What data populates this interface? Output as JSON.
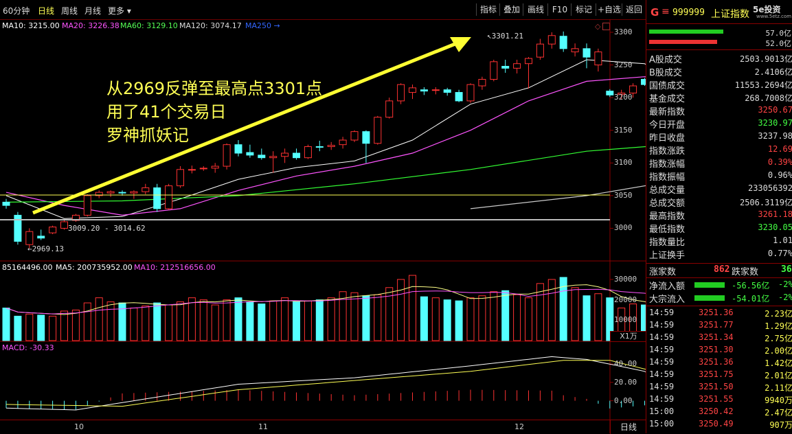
{
  "toolbar": {
    "periods": [
      {
        "label": "60分钟",
        "active": false
      },
      {
        "label": "日线",
        "active": true
      },
      {
        "label": "周线",
        "active": false
      },
      {
        "label": "月线",
        "active": false
      },
      {
        "label": "更多 ▾",
        "active": false
      }
    ],
    "buttons": [
      "指标",
      "叠加",
      "画线",
      "F10",
      "标记",
      "+自选",
      "返回"
    ]
  },
  "ma_line": [
    {
      "label": "MA10: 3215.00",
      "color": "#ffffff"
    },
    {
      "label": "MA20: 3226.38",
      "color": "#ff55ff"
    },
    {
      "label": "MA60: 3129.10",
      "color": "#55ff55"
    },
    {
      "label": "MA120: 3074.17",
      "color": "#dddddd"
    },
    {
      "label": "MA250 →",
      "color": "#3366ff"
    }
  ],
  "vol_line": [
    {
      "label": "85164496.00",
      "color": "#ffffff"
    },
    {
      "label": "MA5: 200735952.00",
      "color": "#ffffff"
    },
    {
      "label": "MA10: 212516656.00",
      "color": "#ff55ff"
    }
  ],
  "macd_label": "MACD: -30.33",
  "annotation": [
    "从2969反弹至最高点3301点",
    "用了41个交易日",
    "罗神抓妖记"
  ],
  "price_labels": {
    "high": "3301.21",
    "low": "2969.13",
    "range": "3009.20 - 3014.62"
  },
  "price_axis": [
    "3300",
    "3250",
    "3200",
    "3150",
    "3100",
    "3050",
    "3000"
  ],
  "vol_axis": [
    "30000",
    "20000",
    "10000"
  ],
  "vol_unit": "X1万",
  "macd_axis": [
    "40.00",
    "20.00",
    "0.00"
  ],
  "date_axis": [
    "10",
    "11",
    "12"
  ],
  "period_tab": "日线",
  "logo": "5e投资",
  "logo_sub": "www.5etz.com",
  "header": {
    "key": "G",
    "code": "999999",
    "name": "上证指数"
  },
  "bars": [
    {
      "value": "57.0亿",
      "color": "#22cc22",
      "fill": 0.72
    },
    {
      "value": "52.0亿",
      "color": "#ee3333",
      "fill": 0.66
    }
  ],
  "stats": [
    {
      "label": "A股成交",
      "value": "2503.9013亿",
      "color": "#dddddd"
    },
    {
      "label": "B股成交",
      "value": "2.4106亿",
      "color": "#dddddd"
    },
    {
      "label": "国债成交",
      "value": "11553.2694亿",
      "color": "#dddddd"
    },
    {
      "label": "基金成交",
      "value": "268.7008亿",
      "color": "#dddddd"
    },
    {
      "label": "最新指数",
      "value": "3250.67",
      "color": "#ff4444"
    },
    {
      "label": "今日开盘",
      "value": "3230.97",
      "color": "#44ff44"
    },
    {
      "label": "昨日收盘",
      "value": "3237.98",
      "color": "#dddddd"
    },
    {
      "label": "指数涨跌",
      "value": "12.69",
      "color": "#ff4444"
    },
    {
      "label": "指数涨幅",
      "value": "0.39%",
      "color": "#ff4444"
    },
    {
      "label": "指数振幅",
      "value": "0.96%",
      "color": "#dddddd"
    },
    {
      "label": "总成交量",
      "value": "233056392",
      "color": "#dddddd"
    },
    {
      "label": "总成交额",
      "value": "2506.3119亿",
      "color": "#dddddd"
    },
    {
      "label": "最高指数",
      "value": "3261.18",
      "color": "#ff4444"
    },
    {
      "label": "最低指数",
      "value": "3230.05",
      "color": "#44ff44"
    },
    {
      "label": "指数量比",
      "value": "1.01",
      "color": "#dddddd"
    },
    {
      "label": "上证换手",
      "value": "0.77%",
      "color": "#dddddd"
    }
  ],
  "breadth": {
    "up_label": "涨家数",
    "up": "862",
    "down_label": "跌家数",
    "down": "360"
  },
  "flows": [
    {
      "label": "净流入额",
      "value": "-56.56亿",
      "pct": "-2%",
      "bar_color": "#22cc22"
    },
    {
      "label": "大宗流入",
      "value": "-54.01亿",
      "pct": "-2%",
      "bar_color": "#22cc22"
    }
  ],
  "ticks": [
    {
      "time": "14:59",
      "price": "3251.36",
      "vol": "2.23亿"
    },
    {
      "time": "14:59",
      "price": "3251.77",
      "vol": "1.29亿"
    },
    {
      "time": "14:59",
      "price": "3251.34",
      "vol": "2.75亿"
    },
    {
      "time": "14:59",
      "price": "3251.30",
      "vol": "2.00亿"
    },
    {
      "time": "14:59",
      "price": "3251.36",
      "vol": "1.42亿"
    },
    {
      "time": "14:59",
      "price": "3251.75",
      "vol": "2.01亿"
    },
    {
      "time": "14:59",
      "price": "3251.50",
      "vol": "2.11亿"
    },
    {
      "time": "14:59",
      "price": "3251.55",
      "vol": "9940万"
    },
    {
      "time": "15:00",
      "price": "3250.42",
      "vol": "2.47亿"
    },
    {
      "time": "15:00",
      "price": "3250.49",
      "vol": "907万"
    }
  ],
  "colors": {
    "up": "#ff3232",
    "down": "#54ffff",
    "bg": "#000000",
    "frame": "#8a0000",
    "annotation": "#ffff55"
  },
  "chart_data": {
    "type": "candlestick",
    "price_range": [
      2950,
      3320
    ],
    "candles": [
      [
        3040,
        3045,
        3030,
        3035
      ],
      [
        3020,
        3025,
        2975,
        2980
      ],
      [
        2975,
        3000,
        2969.13,
        2995
      ],
      [
        2988,
        2998,
        2982,
        2985
      ],
      [
        2993,
        3004,
        2991,
        3002
      ],
      [
        3000,
        3012,
        2998,
        3010
      ],
      [
        3012,
        3022,
        3010,
        3020
      ],
      [
        3020,
        3052,
        3018,
        3050
      ],
      [
        3050,
        3058,
        3046,
        3055
      ],
      [
        3054,
        3058,
        3048,
        3056
      ],
      [
        3055,
        3058,
        3050,
        3054
      ],
      [
        3054,
        3058,
        3045,
        3056
      ],
      [
        3056,
        3068,
        3052,
        3062
      ],
      [
        3062,
        3068,
        3025,
        3030
      ],
      [
        3030,
        3068,
        3028,
        3065
      ],
      [
        3065,
        3095,
        3062,
        3090
      ],
      [
        3090,
        3096,
        3084,
        3090
      ],
      [
        3091,
        3095,
        3088,
        3092
      ],
      [
        3092,
        3100,
        3085,
        3095
      ],
      [
        3095,
        3130,
        3090,
        3128
      ],
      [
        3128,
        3135,
        3110,
        3115
      ],
      [
        3116,
        3128,
        3108,
        3112
      ],
      [
        3112,
        3122,
        3105,
        3108
      ],
      [
        3108,
        3118,
        3085,
        3110
      ],
      [
        3110,
        3122,
        3100,
        3115
      ],
      [
        3115,
        3122,
        3105,
        3108
      ],
      [
        3108,
        3128,
        3106,
        3125
      ],
      [
        3125,
        3134,
        3118,
        3124
      ],
      [
        3125,
        3132,
        3120,
        3127
      ],
      [
        3128,
        3140,
        3122,
        3135
      ],
      [
        3135,
        3150,
        3132,
        3148
      ],
      [
        3148,
        3150,
        3100,
        3130
      ],
      [
        3130,
        3172,
        3128,
        3170
      ],
      [
        3170,
        3200,
        3168,
        3195
      ],
      [
        3195,
        3222,
        3190,
        3220
      ],
      [
        3208,
        3220,
        3198,
        3215
      ],
      [
        3212,
        3216,
        3204,
        3210
      ],
      [
        3212,
        3216,
        3205,
        3212
      ],
      [
        3212,
        3215,
        3203,
        3208
      ],
      [
        3208,
        3212,
        3193,
        3195
      ],
      [
        3195,
        3222,
        3192,
        3220
      ],
      [
        3218,
        3232,
        3212,
        3228
      ],
      [
        3228,
        3258,
        3225,
        3255
      ],
      [
        3248,
        3258,
        3238,
        3245
      ],
      [
        3245,
        3258,
        3237,
        3252
      ],
      [
        3252,
        3262,
        3214,
        3260
      ],
      [
        3262,
        3290,
        3258,
        3282
      ],
      [
        3282,
        3300,
        3275,
        3295
      ],
      [
        3294,
        3301.21,
        3270,
        3275
      ],
      [
        3270,
        3283,
        3263,
        3275
      ],
      [
        3275,
        3283,
        3245,
        3262
      ],
      [
        3250,
        3275,
        3240,
        3270
      ],
      [
        3210,
        3213,
        3201,
        3204
      ],
      [
        3205,
        3212,
        3198,
        3207
      ],
      [
        3207,
        3222,
        3200,
        3218
      ],
      [
        3228,
        3230,
        3218,
        3220
      ],
      [
        3223,
        3230,
        3212,
        3225
      ],
      [
        3233,
        3238,
        3148,
        3152
      ],
      [
        3152,
        3162,
        3128,
        3145
      ]
    ],
    "volume": [
      16000,
      12000,
      13000,
      12500,
      12000,
      14500,
      15000,
      18500,
      21000,
      19000,
      18500,
      16000,
      17000,
      18500,
      17500,
      19000,
      21000,
      20000,
      17500,
      20000,
      21000,
      19000,
      18000,
      19500,
      21000,
      19000,
      19500,
      20000,
      21000,
      24000,
      23500,
      22000,
      22500,
      26000,
      30000,
      32000,
      21500,
      21000,
      20000,
      19500,
      21000,
      22000,
      24000,
      24500,
      22500,
      21000,
      28000,
      30000,
      31000,
      26000,
      22000,
      23000,
      21000,
      16000,
      18000,
      17500,
      16500,
      28000,
      19000
    ],
    "ma_series": {
      "MA10": [
        [
          0,
          3050
        ],
        [
          5,
          3015
        ],
        [
          10,
          3018
        ],
        [
          15,
          3045
        ],
        [
          20,
          3075
        ],
        [
          25,
          3093
        ],
        [
          30,
          3103
        ],
        [
          35,
          3135
        ],
        [
          40,
          3190
        ],
        [
          45,
          3215
        ],
        [
          50,
          3258
        ],
        [
          55,
          3252
        ],
        [
          58,
          3215
        ]
      ],
      "MA20": [
        [
          0,
          3055
        ],
        [
          5,
          3035
        ],
        [
          10,
          3020
        ],
        [
          15,
          3030
        ],
        [
          20,
          3058
        ],
        [
          25,
          3080
        ],
        [
          30,
          3095
        ],
        [
          35,
          3115
        ],
        [
          40,
          3150
        ],
        [
          45,
          3195
        ],
        [
          50,
          3225
        ],
        [
          55,
          3232
        ],
        [
          58,
          3226
        ]
      ],
      "MA60": [
        [
          0,
          3040
        ],
        [
          10,
          3042
        ],
        [
          20,
          3050
        ],
        [
          30,
          3068
        ],
        [
          40,
          3090
        ],
        [
          50,
          3118
        ],
        [
          58,
          3129
        ]
      ],
      "MA120": [
        [
          40,
          3030
        ],
        [
          50,
          3050
        ],
        [
          58,
          3074
        ]
      ]
    },
    "macd_series": {
      "DIF": [
        [
          0,
          -8
        ],
        [
          6,
          -10
        ],
        [
          10,
          -2
        ],
        [
          20,
          18
        ],
        [
          30,
          25
        ],
        [
          40,
          38
        ],
        [
          47,
          48
        ],
        [
          50,
          45
        ],
        [
          55,
          32
        ],
        [
          58,
          10
        ]
      ],
      "DEA": [
        [
          0,
          -4
        ],
        [
          10,
          -6
        ],
        [
          20,
          12
        ],
        [
          30,
          22
        ],
        [
          40,
          32
        ],
        [
          48,
          44
        ],
        [
          52,
          44
        ],
        [
          58,
          25
        ]
      ]
    },
    "price_axis_ticks": [
      3000,
      3050,
      3100,
      3150,
      3200,
      3250,
      3300
    ],
    "vol_axis_ticks": [
      10000,
      20000,
      30000
    ],
    "macd_axis_ticks": [
      0,
      20,
      40
    ]
  }
}
